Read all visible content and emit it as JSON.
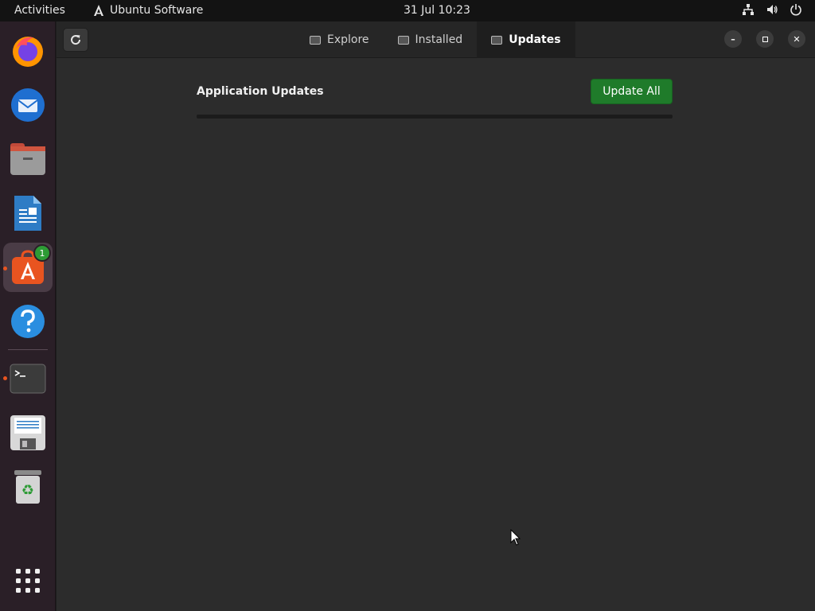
{
  "topbar": {
    "activities": "Activities",
    "app_name": "Ubuntu Software",
    "clock": "31 Jul  10:23",
    "tray_icons": [
      "network-icon",
      "volume-icon",
      "power-icon"
    ]
  },
  "dock": {
    "items": [
      {
        "name": "firefox-icon"
      },
      {
        "name": "thunderbird-icon"
      },
      {
        "name": "files-icon"
      },
      {
        "name": "libreoffice-writer-icon"
      },
      {
        "name": "ubuntu-software-icon",
        "badge": "1",
        "active": true
      },
      {
        "name": "help-icon"
      },
      {
        "name": "terminal-icon"
      },
      {
        "name": "save-disk-icon"
      },
      {
        "name": "trash-icon"
      },
      {
        "name": "show-apps-icon"
      }
    ]
  },
  "headerbar": {
    "tabs": [
      {
        "label": "Explore"
      },
      {
        "label": "Installed"
      },
      {
        "label": "Updates",
        "selected": true
      }
    ]
  },
  "main": {
    "section_title": "Application Updates",
    "update_all_label": "Update All",
    "progress_fraction": 0
  },
  "colors": {
    "accent_green": "#1f7b2a",
    "badge_green": "#2d9b35",
    "ubuntu_orange": "#e95420"
  }
}
